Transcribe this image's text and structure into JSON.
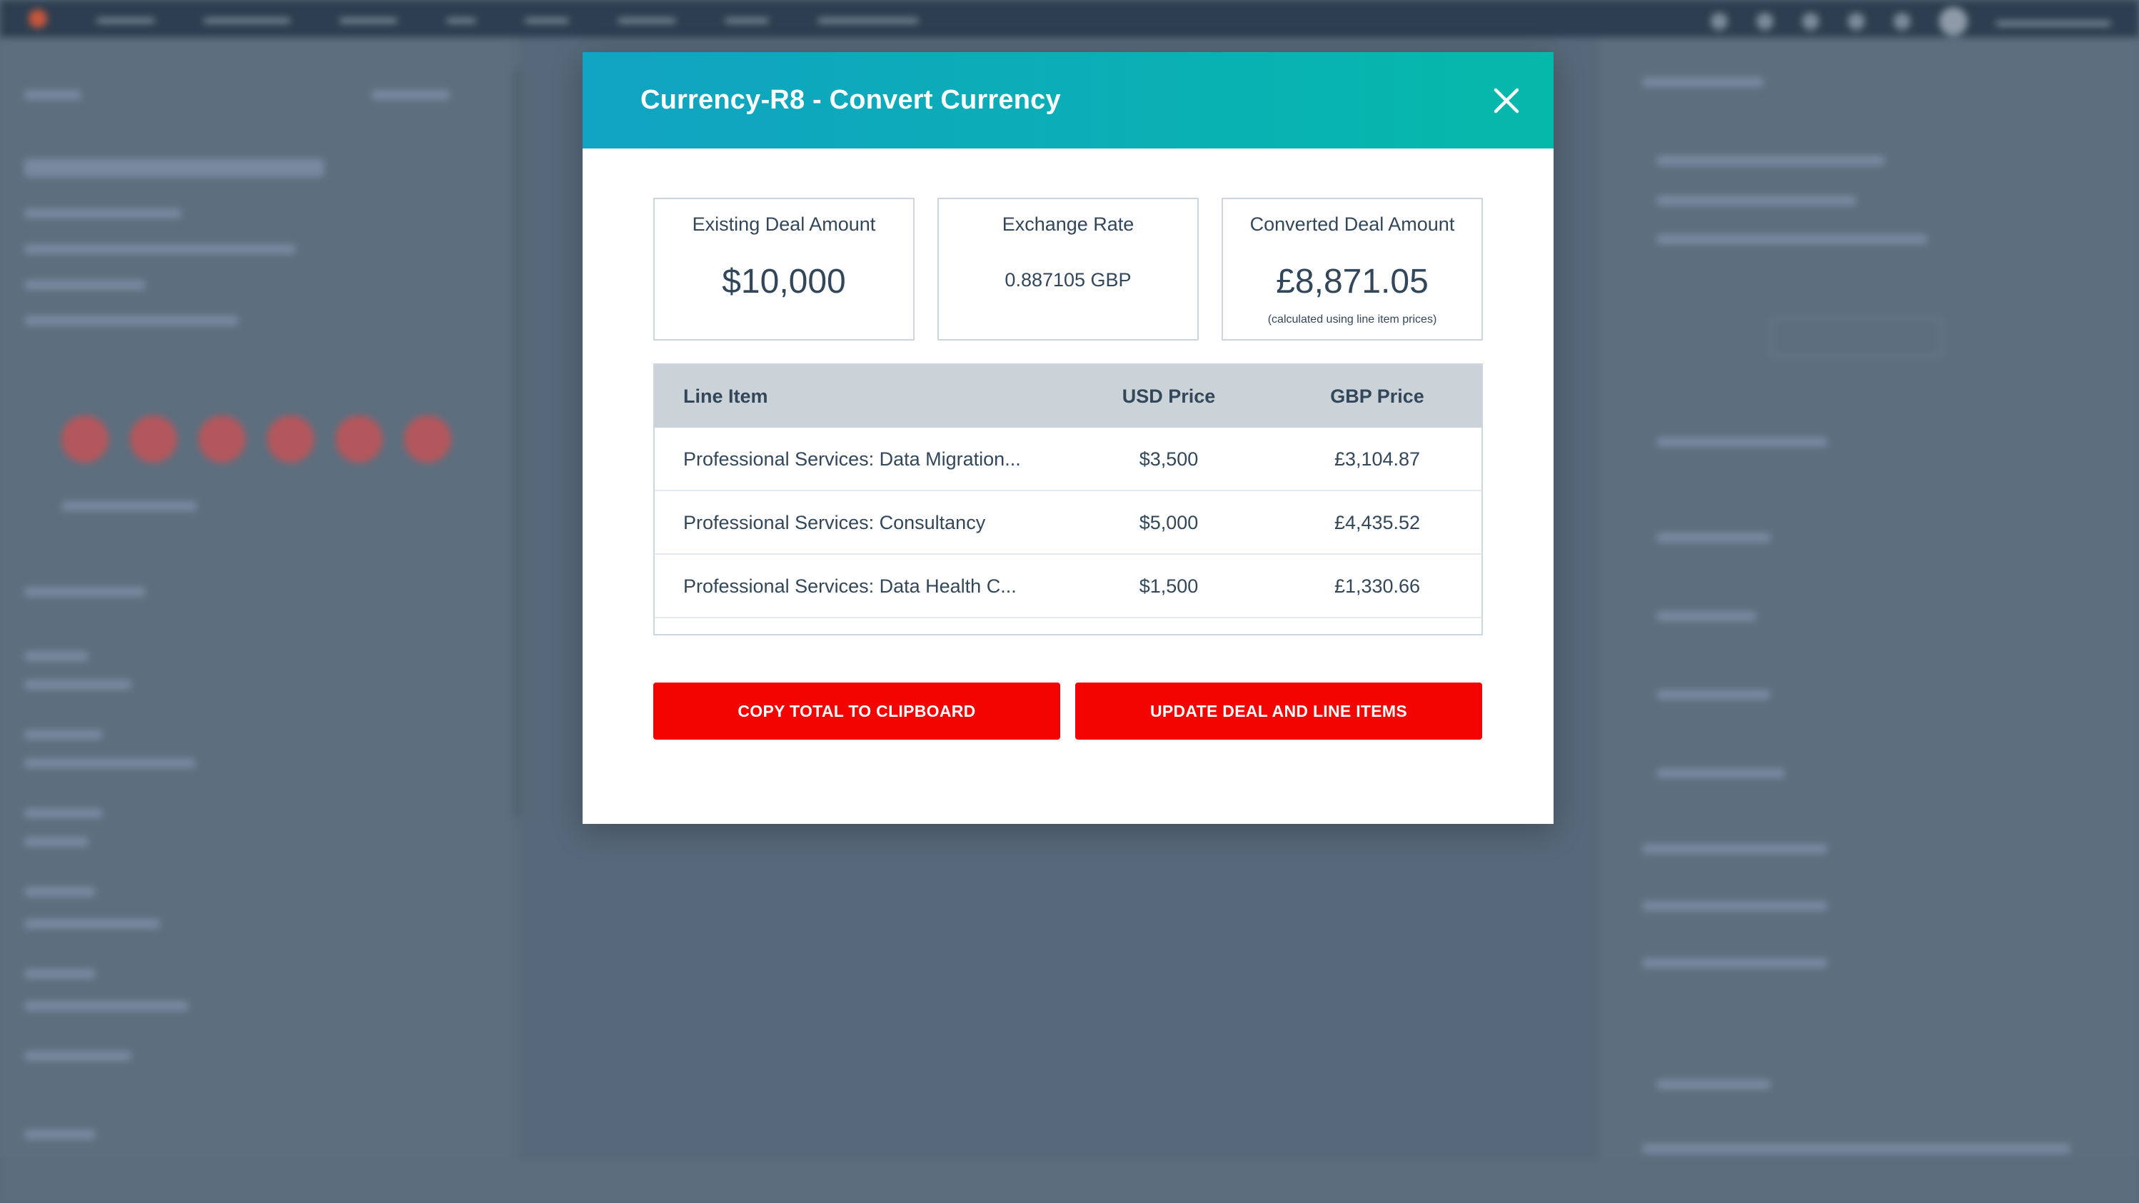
{
  "modal": {
    "title": "Currency-R8 - Convert Currency",
    "close_icon": "close-icon",
    "header_gradient": [
      "#11a3c3",
      "#05b9aa"
    ],
    "cards": {
      "existing": {
        "label": "Existing Deal Amount",
        "value": "$10,000"
      },
      "rate": {
        "label": "Exchange Rate",
        "value": "0.887105 GBP"
      },
      "converted": {
        "label": "Converted Deal Amount",
        "value": "£8,871.05",
        "note": "(calculated using line item prices)"
      }
    },
    "table": {
      "headers": {
        "item": "Line Item",
        "usd": "USD Price",
        "gbp": "GBP Price"
      },
      "rows": [
        {
          "item": "Professional Services: Data Migration...",
          "usd": "$3,500",
          "gbp": "£3,104.87"
        },
        {
          "item": "Professional Services: Consultancy",
          "usd": "$5,000",
          "gbp": "£4,435.52"
        },
        {
          "item": "Professional Services: Data Health C...",
          "usd": "$1,500",
          "gbp": "£1,330.66"
        }
      ]
    },
    "buttons": {
      "copy": "COPY TOTAL TO CLIPBOARD",
      "update": "UPDATE DEAL AND LINE ITEMS",
      "color": "#f40400"
    }
  }
}
